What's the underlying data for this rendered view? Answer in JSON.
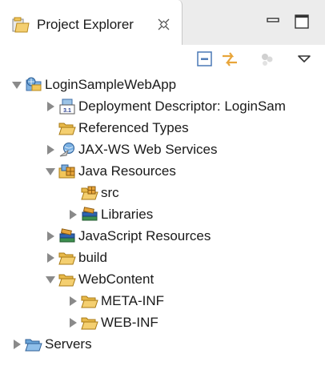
{
  "tab": {
    "title": "Project Explorer"
  },
  "tree": {
    "project": "LoginSampleWebApp",
    "deployment_descriptor": "Deployment Descriptor: LoginSam",
    "referenced_types": "Referenced Types",
    "jaxws": "JAX-WS Web Services",
    "java_resources": "Java Resources",
    "src": "src",
    "libraries": "Libraries",
    "javascript_resources": "JavaScript Resources",
    "build": "build",
    "webcontent": "WebContent",
    "meta_inf": "META-INF",
    "web_inf": "WEB-INF",
    "servers": "Servers"
  },
  "icons": {
    "tab": "project-explorer-icon",
    "close": "close-icon",
    "minimize": "minimize-icon",
    "maximize": "maximize-icon",
    "collapse_all": "collapse-all-icon",
    "link_with_editor": "link-with-editor-icon",
    "filters": "filters-icon",
    "view_menu": "view-menu-icon"
  },
  "colors": {
    "folder": "#f2c65a",
    "folder_outline": "#b88a1c",
    "twisty": "#8a8a8a",
    "selection": "#ffffff"
  }
}
